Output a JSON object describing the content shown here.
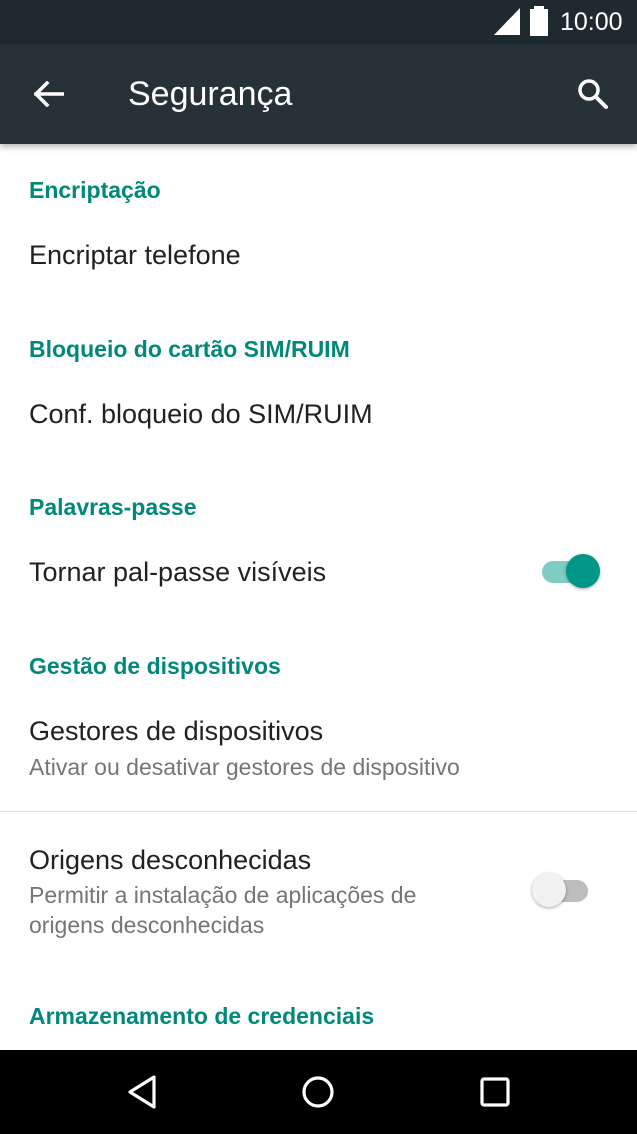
{
  "status_bar": {
    "time": "10:00",
    "icons": [
      "signal-icon",
      "battery-icon"
    ]
  },
  "app_bar": {
    "title": "Segurança",
    "back_icon": "arrow-back-icon",
    "search_icon": "search-icon"
  },
  "sections": [
    {
      "header": "Encriptação",
      "items": [
        {
          "title": "Encriptar telefone"
        }
      ]
    },
    {
      "header": "Bloqueio do cartão SIM/RUIM",
      "items": [
        {
          "title": "Conf. bloqueio do SIM/RUIM"
        }
      ]
    },
    {
      "header": "Palavras-passe",
      "items": [
        {
          "title": "Tornar pal-passe visíveis",
          "toggle": true
        }
      ]
    },
    {
      "header": "Gestão de dispositivos",
      "items": [
        {
          "title": "Gestores de dispositivos",
          "summary": "Ativar ou desativar gestores de dispositivo"
        },
        {
          "title": "Origens desconhecidas",
          "summary_line1": "Permitir a instalação de aplicações de",
          "summary_line2": "origens desconhecidas",
          "toggle": false
        }
      ]
    },
    {
      "header": "Armazenamento de credenciais",
      "items": []
    }
  ],
  "colors": {
    "status_bar": "#1f2a30",
    "app_bar": "#263238",
    "accent": "#00897b",
    "toggle_on": "#009688"
  },
  "nav_bar": {
    "icons": [
      "back-triangle-icon",
      "home-circle-icon",
      "recents-square-icon"
    ]
  }
}
